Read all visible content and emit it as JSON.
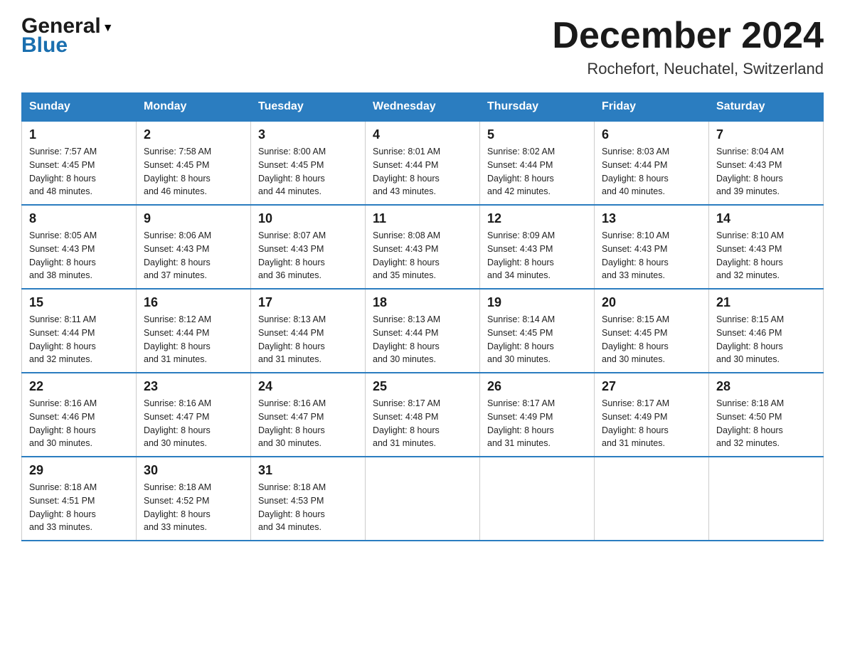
{
  "header": {
    "logo_general": "General",
    "logo_blue": "Blue",
    "month_title": "December 2024",
    "location": "Rochefort, Neuchatel, Switzerland"
  },
  "days_of_week": [
    "Sunday",
    "Monday",
    "Tuesday",
    "Wednesday",
    "Thursday",
    "Friday",
    "Saturday"
  ],
  "weeks": [
    [
      {
        "day": "1",
        "sunrise": "7:57 AM",
        "sunset": "4:45 PM",
        "daylight": "8 hours and 48 minutes."
      },
      {
        "day": "2",
        "sunrise": "7:58 AM",
        "sunset": "4:45 PM",
        "daylight": "8 hours and 46 minutes."
      },
      {
        "day": "3",
        "sunrise": "8:00 AM",
        "sunset": "4:45 PM",
        "daylight": "8 hours and 44 minutes."
      },
      {
        "day": "4",
        "sunrise": "8:01 AM",
        "sunset": "4:44 PM",
        "daylight": "8 hours and 43 minutes."
      },
      {
        "day": "5",
        "sunrise": "8:02 AM",
        "sunset": "4:44 PM",
        "daylight": "8 hours and 42 minutes."
      },
      {
        "day": "6",
        "sunrise": "8:03 AM",
        "sunset": "4:44 PM",
        "daylight": "8 hours and 40 minutes."
      },
      {
        "day": "7",
        "sunrise": "8:04 AM",
        "sunset": "4:43 PM",
        "daylight": "8 hours and 39 minutes."
      }
    ],
    [
      {
        "day": "8",
        "sunrise": "8:05 AM",
        "sunset": "4:43 PM",
        "daylight": "8 hours and 38 minutes."
      },
      {
        "day": "9",
        "sunrise": "8:06 AM",
        "sunset": "4:43 PM",
        "daylight": "8 hours and 37 minutes."
      },
      {
        "day": "10",
        "sunrise": "8:07 AM",
        "sunset": "4:43 PM",
        "daylight": "8 hours and 36 minutes."
      },
      {
        "day": "11",
        "sunrise": "8:08 AM",
        "sunset": "4:43 PM",
        "daylight": "8 hours and 35 minutes."
      },
      {
        "day": "12",
        "sunrise": "8:09 AM",
        "sunset": "4:43 PM",
        "daylight": "8 hours and 34 minutes."
      },
      {
        "day": "13",
        "sunrise": "8:10 AM",
        "sunset": "4:43 PM",
        "daylight": "8 hours and 33 minutes."
      },
      {
        "day": "14",
        "sunrise": "8:10 AM",
        "sunset": "4:43 PM",
        "daylight": "8 hours and 32 minutes."
      }
    ],
    [
      {
        "day": "15",
        "sunrise": "8:11 AM",
        "sunset": "4:44 PM",
        "daylight": "8 hours and 32 minutes."
      },
      {
        "day": "16",
        "sunrise": "8:12 AM",
        "sunset": "4:44 PM",
        "daylight": "8 hours and 31 minutes."
      },
      {
        "day": "17",
        "sunrise": "8:13 AM",
        "sunset": "4:44 PM",
        "daylight": "8 hours and 31 minutes."
      },
      {
        "day": "18",
        "sunrise": "8:13 AM",
        "sunset": "4:44 PM",
        "daylight": "8 hours and 30 minutes."
      },
      {
        "day": "19",
        "sunrise": "8:14 AM",
        "sunset": "4:45 PM",
        "daylight": "8 hours and 30 minutes."
      },
      {
        "day": "20",
        "sunrise": "8:15 AM",
        "sunset": "4:45 PM",
        "daylight": "8 hours and 30 minutes."
      },
      {
        "day": "21",
        "sunrise": "8:15 AM",
        "sunset": "4:46 PM",
        "daylight": "8 hours and 30 minutes."
      }
    ],
    [
      {
        "day": "22",
        "sunrise": "8:16 AM",
        "sunset": "4:46 PM",
        "daylight": "8 hours and 30 minutes."
      },
      {
        "day": "23",
        "sunrise": "8:16 AM",
        "sunset": "4:47 PM",
        "daylight": "8 hours and 30 minutes."
      },
      {
        "day": "24",
        "sunrise": "8:16 AM",
        "sunset": "4:47 PM",
        "daylight": "8 hours and 30 minutes."
      },
      {
        "day": "25",
        "sunrise": "8:17 AM",
        "sunset": "4:48 PM",
        "daylight": "8 hours and 31 minutes."
      },
      {
        "day": "26",
        "sunrise": "8:17 AM",
        "sunset": "4:49 PM",
        "daylight": "8 hours and 31 minutes."
      },
      {
        "day": "27",
        "sunrise": "8:17 AM",
        "sunset": "4:49 PM",
        "daylight": "8 hours and 31 minutes."
      },
      {
        "day": "28",
        "sunrise": "8:18 AM",
        "sunset": "4:50 PM",
        "daylight": "8 hours and 32 minutes."
      }
    ],
    [
      {
        "day": "29",
        "sunrise": "8:18 AM",
        "sunset": "4:51 PM",
        "daylight": "8 hours and 33 minutes."
      },
      {
        "day": "30",
        "sunrise": "8:18 AM",
        "sunset": "4:52 PM",
        "daylight": "8 hours and 33 minutes."
      },
      {
        "day": "31",
        "sunrise": "8:18 AM",
        "sunset": "4:53 PM",
        "daylight": "8 hours and 34 minutes."
      },
      null,
      null,
      null,
      null
    ]
  ],
  "labels": {
    "sunrise": "Sunrise:",
    "sunset": "Sunset:",
    "daylight": "Daylight:"
  }
}
